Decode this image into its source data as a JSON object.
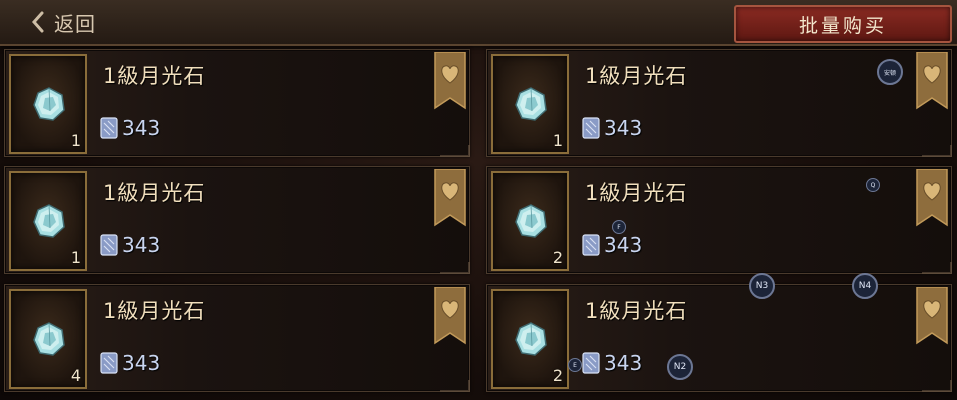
{
  "topbar": {
    "back_label": "返回",
    "bulk_buy_label": "批量购买"
  },
  "currency_icon": "silver-card-icon",
  "gem_icon": "moonstone-gem-icon",
  "fav_icon": "heart-bookmark-icon",
  "colors": {
    "accent_red": "#8a2a22",
    "gold_border": "#8a6d3a"
  },
  "listings": [
    {
      "name": "1級月光石",
      "qty": "1",
      "price": "343"
    },
    {
      "name": "1級月光石",
      "qty": "1",
      "price": "343"
    },
    {
      "name": "1級月光石",
      "qty": "1",
      "price": "343"
    },
    {
      "name": "1級月光石",
      "qty": "2",
      "price": "343"
    },
    {
      "name": "1級月光石",
      "qty": "4",
      "price": "343"
    },
    {
      "name": "1級月光石",
      "qty": "2",
      "price": "343"
    }
  ],
  "markers": {
    "m1": "安顿",
    "m2": "Q",
    "m3": "F",
    "m4": "N3",
    "m5": "N4",
    "m6": "E",
    "m7": "N2"
  }
}
